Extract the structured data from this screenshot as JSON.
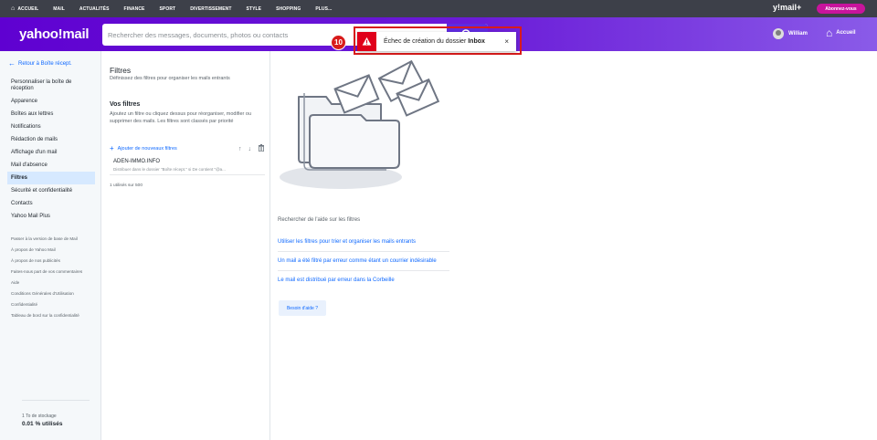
{
  "topnav": {
    "items": [
      "ACCUEIL",
      "MAIL",
      "ACTUALITÉS",
      "FINANCE",
      "SPORT",
      "DIVERTISSEMENT",
      "STYLE",
      "SHOPPING",
      "PLUS..."
    ],
    "brand": "y!mail+",
    "subscribe": "Abonnez-vous"
  },
  "header": {
    "logo": "yahoo!mail",
    "search_placeholder": "Rechercher des messages, documents, photos ou contacts",
    "user_name": "William",
    "home_label": "Accueil"
  },
  "toast": {
    "step": "10",
    "message_prefix": "Échec de création du dossier",
    "message_bold": "Inbox",
    "close": "×"
  },
  "sidebar": {
    "back": "Retour à Boîte récept.",
    "items": [
      "Personnaliser la boîte de réception",
      "Apparence",
      "Boîtes aux lettres",
      "Notifications",
      "Rédaction de mails",
      "Affichage d'un mail",
      "Mail d'absence",
      "Filtres",
      "Sécurité et confidentialité",
      "Contacts",
      "Yahoo Mail Plus"
    ],
    "minor_items": [
      "Passer à la version de base de Mail",
      "À propos de Yahoo Mail",
      "À propos de nos publicités",
      "Faites-nous part de vos commentaires",
      "Aide",
      "Conditions Générales d'Utilisation",
      "Confidentialité",
      "Tableau de bord sur la confidentialité"
    ],
    "storage_label": "1 To de stockage",
    "storage_value": "0.01 % utilisés"
  },
  "filters": {
    "title": "Filtres",
    "subtitle": "Définissez des filtres pour organiser les mails entrants",
    "section_title": "Vos filtres",
    "section_desc": "Ajoutez un filtre ou cliquez dessus pour réorganiser, modifier ou supprimer des mails. Les filtres sont classés par priorité",
    "add_label": "Ajouter de nouveaux filtres",
    "item_name": "ADEN-IMMO.INFO",
    "item_detail": "Distribuer dans le dossier \"Boîte récept.\" si De contient \"@a...",
    "count": "1 utilisés sur 500"
  },
  "help": {
    "title": "Rechercher de l'aide sur les filtres",
    "links": [
      "Utiliser les filtres pour trier et organiser les mails entrants",
      "Un mail a été filtré par erreur comme étant un courrier indésirable",
      "Le mail est distribué par erreur dans la Corbeille"
    ],
    "button": "Besoin d'aide ?"
  },
  "colors": {
    "accent": "#0f69ff",
    "header": "#5f01d1",
    "error": "#e0001b",
    "subscribe": "#c8149c"
  }
}
